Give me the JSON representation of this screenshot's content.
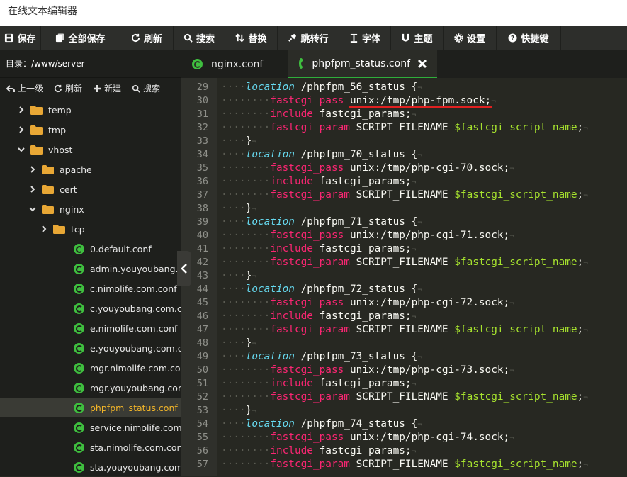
{
  "window": {
    "title": "在线文本编辑器"
  },
  "toolbar": [
    {
      "name": "save-button",
      "icon": "save-icon",
      "label": "保存",
      "width": 58
    },
    {
      "name": "save-all-button",
      "icon": "save-all-icon",
      "label": "全部保存",
      "width": 112
    },
    {
      "name": "refresh-button",
      "icon": "refresh-icon",
      "label": "刷新",
      "width": 75
    },
    {
      "name": "search-button",
      "icon": "search-icon",
      "label": "搜索",
      "width": 73
    },
    {
      "name": "replace-button",
      "icon": "replace-icon",
      "label": "替换",
      "width": 74
    },
    {
      "name": "goto-line-button",
      "icon": "pin-icon",
      "label": "跳转行",
      "width": 87
    },
    {
      "name": "font-button",
      "icon": "text-icon",
      "label": "字体",
      "width": 73
    },
    {
      "name": "theme-button",
      "icon": "magnet-icon",
      "label": "主题",
      "width": 74
    },
    {
      "name": "settings-button",
      "icon": "gear-icon",
      "label": "设置",
      "width": 75
    },
    {
      "name": "shortcuts-button",
      "icon": "question-icon",
      "label": "快捷键",
      "width": 91
    }
  ],
  "sidebar": {
    "dir_label": "目录：",
    "dir_path": "/www/server",
    "actions": [
      {
        "name": "up-level-button",
        "icon": "back-arrow-icon",
        "label": "上一级"
      },
      {
        "name": "refresh-tree-button",
        "icon": "refresh-icon",
        "label": "刷新"
      },
      {
        "name": "new-button",
        "icon": "plus-icon",
        "label": "新建"
      },
      {
        "name": "search-tree-button",
        "icon": "search-icon",
        "label": "搜索"
      }
    ],
    "tree": [
      {
        "type": "folder",
        "label": "temp",
        "depth": 1,
        "state": "closed"
      },
      {
        "type": "folder",
        "label": "tmp",
        "depth": 1,
        "state": "closed"
      },
      {
        "type": "folder",
        "label": "vhost",
        "depth": 1,
        "state": "open"
      },
      {
        "type": "folder",
        "label": "apache",
        "depth": 2,
        "state": "closed"
      },
      {
        "type": "folder",
        "label": "cert",
        "depth": 2,
        "state": "closed"
      },
      {
        "type": "folder",
        "label": "nginx",
        "depth": 2,
        "state": "open"
      },
      {
        "type": "folder",
        "label": "tcp",
        "depth": 3,
        "state": "closed"
      },
      {
        "type": "file",
        "label": "0.default.conf",
        "depth": 3
      },
      {
        "type": "file",
        "label": "admin.youyoubang.co...",
        "depth": 3
      },
      {
        "type": "file",
        "label": "c.nimolife.com.conf",
        "depth": 3
      },
      {
        "type": "file",
        "label": "c.youyoubang.com.conf",
        "depth": 3
      },
      {
        "type": "file",
        "label": "e.nimolife.com.conf",
        "depth": 3
      },
      {
        "type": "file",
        "label": "e.youyoubang.com.conf",
        "depth": 3
      },
      {
        "type": "file",
        "label": "mgr.nimolife.com.conf",
        "depth": 3
      },
      {
        "type": "file",
        "label": "mgr.youyoubang.com....",
        "depth": 3
      },
      {
        "type": "file",
        "label": "phpfpm_status.conf",
        "depth": 3,
        "active": true
      },
      {
        "type": "file",
        "label": "service.nimolife.com.conf",
        "depth": 3
      },
      {
        "type": "file",
        "label": "sta.nimolife.com.conf",
        "depth": 3
      },
      {
        "type": "file",
        "label": "sta.youyoubang.com.c...",
        "depth": 3
      }
    ]
  },
  "tabs": [
    {
      "label": "nginx.conf",
      "active": false
    },
    {
      "label": "phpfpm_status.conf",
      "active": true,
      "closable": true
    }
  ],
  "colors": {
    "keyword": "#66d9ef",
    "directive": "#f92672",
    "variable": "#a6e22e",
    "text": "#f8f8f2",
    "highlight_underline": "#e02020",
    "active_file": "#f0b429",
    "file_icon": "#3fbf3f"
  },
  "editor": {
    "first_line": 29,
    "highlighted_line": 30,
    "lines": [
      {
        "n": 29,
        "indent": 1,
        "parts": [
          [
            "kw",
            "location"
          ],
          [
            "t",
            " /phpfpm_56_status {"
          ]
        ]
      },
      {
        "n": 30,
        "indent": 2,
        "parts": [
          [
            "dir",
            "fastcgi_pass"
          ],
          [
            "t",
            " unix:/tmp/php-fpm.sock;"
          ]
        ]
      },
      {
        "n": 31,
        "indent": 2,
        "parts": [
          [
            "dir",
            "include"
          ],
          [
            "t",
            " fastcgi_params;"
          ]
        ]
      },
      {
        "n": 32,
        "indent": 2,
        "parts": [
          [
            "dir",
            "fastcgi_param"
          ],
          [
            "t",
            " SCRIPT_FILENAME "
          ],
          [
            "var",
            "$fastcgi_script_name"
          ],
          [
            "t",
            ";"
          ]
        ]
      },
      {
        "n": 33,
        "indent": 1,
        "parts": [
          [
            "t",
            "}"
          ]
        ]
      },
      {
        "n": 34,
        "indent": 1,
        "parts": [
          [
            "kw",
            "location"
          ],
          [
            "t",
            " /phpfpm_70_status {"
          ]
        ]
      },
      {
        "n": 35,
        "indent": 2,
        "parts": [
          [
            "dir",
            "fastcgi_pass"
          ],
          [
            "t",
            " unix:/tmp/php-cgi-70.sock;"
          ]
        ]
      },
      {
        "n": 36,
        "indent": 2,
        "parts": [
          [
            "dir",
            "include"
          ],
          [
            "t",
            " fastcgi_params;"
          ]
        ]
      },
      {
        "n": 37,
        "indent": 2,
        "parts": [
          [
            "dir",
            "fastcgi_param"
          ],
          [
            "t",
            " SCRIPT_FILENAME "
          ],
          [
            "var",
            "$fastcgi_script_name"
          ],
          [
            "t",
            ";"
          ]
        ]
      },
      {
        "n": 38,
        "indent": 1,
        "parts": [
          [
            "t",
            "}"
          ]
        ]
      },
      {
        "n": 39,
        "indent": 1,
        "parts": [
          [
            "kw",
            "location"
          ],
          [
            "t",
            " /phpfpm_71_status {"
          ]
        ]
      },
      {
        "n": 40,
        "indent": 2,
        "parts": [
          [
            "dir",
            "fastcgi_pass"
          ],
          [
            "t",
            " unix:/tmp/php-cgi-71.sock;"
          ]
        ]
      },
      {
        "n": 41,
        "indent": 2,
        "parts": [
          [
            "dir",
            "include"
          ],
          [
            "t",
            " fastcgi_params;"
          ]
        ]
      },
      {
        "n": 42,
        "indent": 2,
        "parts": [
          [
            "dir",
            "fastcgi_param"
          ],
          [
            "t",
            " SCRIPT_FILENAME "
          ],
          [
            "var",
            "$fastcgi_script_name"
          ],
          [
            "t",
            ";"
          ]
        ]
      },
      {
        "n": 43,
        "indent": 1,
        "parts": [
          [
            "t",
            "}"
          ]
        ]
      },
      {
        "n": 44,
        "indent": 1,
        "parts": [
          [
            "kw",
            "location"
          ],
          [
            "t",
            " /phpfpm_72_status {"
          ]
        ]
      },
      {
        "n": 45,
        "indent": 2,
        "parts": [
          [
            "dir",
            "fastcgi_pass"
          ],
          [
            "t",
            " unix:/tmp/php-cgi-72.sock;"
          ]
        ]
      },
      {
        "n": 46,
        "indent": 2,
        "parts": [
          [
            "dir",
            "include"
          ],
          [
            "t",
            " fastcgi_params;"
          ]
        ]
      },
      {
        "n": 47,
        "indent": 2,
        "parts": [
          [
            "dir",
            "fastcgi_param"
          ],
          [
            "t",
            " SCRIPT_FILENAME "
          ],
          [
            "var",
            "$fastcgi_script_name"
          ],
          [
            "t",
            ";"
          ]
        ]
      },
      {
        "n": 48,
        "indent": 1,
        "parts": [
          [
            "t",
            "}"
          ]
        ]
      },
      {
        "n": 49,
        "indent": 1,
        "parts": [
          [
            "kw",
            "location"
          ],
          [
            "t",
            " /phpfpm_73_status {"
          ]
        ]
      },
      {
        "n": 50,
        "indent": 2,
        "parts": [
          [
            "dir",
            "fastcgi_pass"
          ],
          [
            "t",
            " unix:/tmp/php-cgi-73.sock;"
          ]
        ]
      },
      {
        "n": 51,
        "indent": 2,
        "parts": [
          [
            "dir",
            "include"
          ],
          [
            "t",
            " fastcgi_params;"
          ]
        ]
      },
      {
        "n": 52,
        "indent": 2,
        "parts": [
          [
            "dir",
            "fastcgi_param"
          ],
          [
            "t",
            " SCRIPT_FILENAME "
          ],
          [
            "var",
            "$fastcgi_script_name"
          ],
          [
            "t",
            ";"
          ]
        ]
      },
      {
        "n": 53,
        "indent": 1,
        "parts": [
          [
            "t",
            "}"
          ]
        ]
      },
      {
        "n": 54,
        "indent": 1,
        "parts": [
          [
            "kw",
            "location"
          ],
          [
            "t",
            " /phpfpm_74_status {"
          ]
        ]
      },
      {
        "n": 55,
        "indent": 2,
        "parts": [
          [
            "dir",
            "fastcgi_pass"
          ],
          [
            "t",
            " unix:/tmp/php-cgi-74.sock;"
          ]
        ]
      },
      {
        "n": 56,
        "indent": 2,
        "parts": [
          [
            "dir",
            "include"
          ],
          [
            "t",
            " fastcgi_params;"
          ]
        ]
      },
      {
        "n": 57,
        "indent": 2,
        "parts": [
          [
            "dir",
            "fastcgi_param"
          ],
          [
            "t",
            " SCRIPT_FILENAME "
          ],
          [
            "var",
            "$fastcgi_script_name"
          ],
          [
            "t",
            ";"
          ]
        ]
      }
    ]
  }
}
